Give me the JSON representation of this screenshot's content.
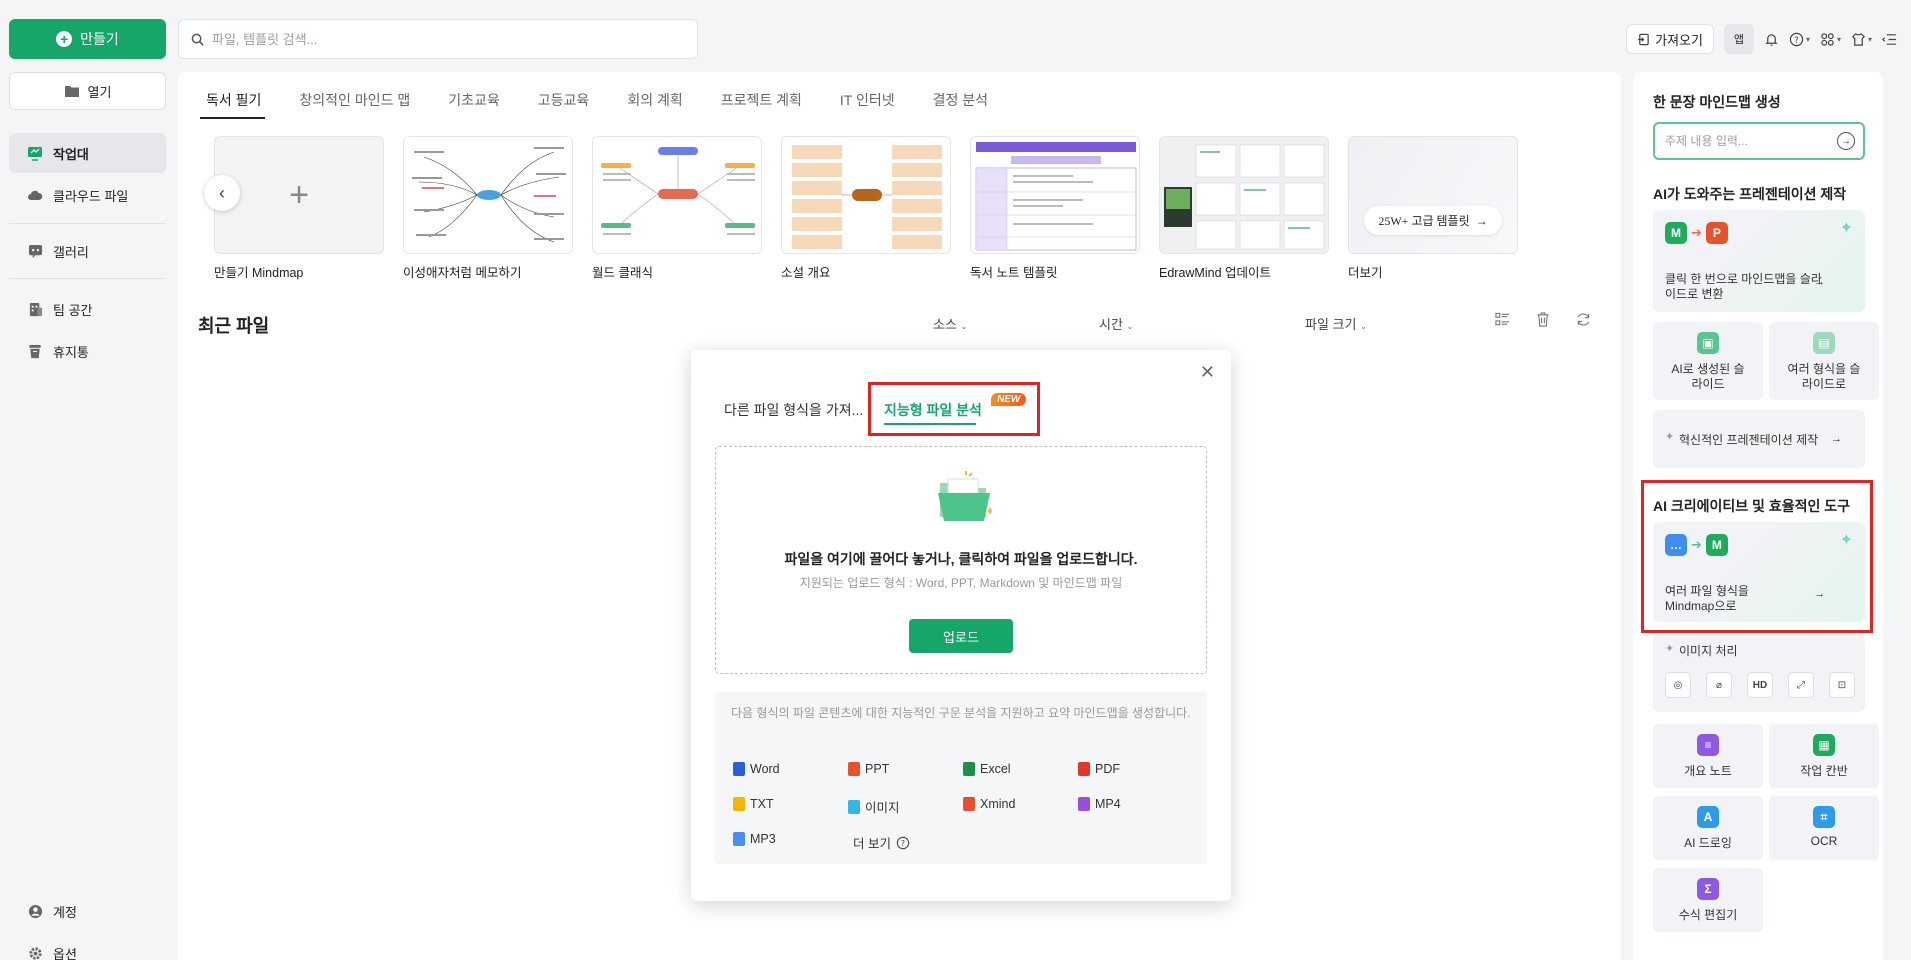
{
  "toolbar": {
    "create_label": "만들기",
    "search_placeholder": "파일, 템플릿 검색...",
    "import_label": "가져오기",
    "app_label": "앱"
  },
  "sidebar": {
    "open_label": "열기",
    "items": [
      {
        "label": "작업대"
      },
      {
        "label": "클라우드 파일"
      },
      {
        "label": "갤러리"
      },
      {
        "label": "팀 공간"
      },
      {
        "label": "휴지통"
      }
    ],
    "bottom": [
      {
        "label": "계정"
      },
      {
        "label": "옵션"
      }
    ]
  },
  "main": {
    "tabs": [
      {
        "label": "독서 필기"
      },
      {
        "label": "창의적인 마인드 맵"
      },
      {
        "label": "기초교육"
      },
      {
        "label": "고등교육"
      },
      {
        "label": "회의 계획"
      },
      {
        "label": "프로젝트 계획"
      },
      {
        "label": "IT 인터넷"
      },
      {
        "label": "결정 분석"
      }
    ],
    "templates": [
      {
        "label": "만들기 Mindmap"
      },
      {
        "label": "이성애자처럼 메모하기"
      },
      {
        "label": "월드 클래식"
      },
      {
        "label": "소설 개요"
      },
      {
        "label": "독서 노트 템플릿"
      },
      {
        "label": "EdrawMind 업데이트"
      },
      {
        "label": "더보기"
      }
    ],
    "more_pill": "25W+ 고급 템플릿",
    "recent_title": "최근 파일",
    "columns": {
      "source": "소스",
      "time": "시간",
      "size": "파일 크기"
    }
  },
  "dialog": {
    "tab1": "다른 파일 형식을 가져...",
    "tab2": "지능형 파일 분석",
    "badge": "NEW",
    "drop_main": "파일을 여기에 끌어다 놓거나, 클릭하여 파일을 업로드합니다.",
    "drop_sub": "지원되는 업로드 형식 : Word, PPT, Markdown 및 마인드맵 파일",
    "upload_label": "업로드",
    "info": "다음 형식의 파일 콘텐츠에 대한 지능적인 구문 분석을 지원하고 요약 마인드맵을 생성합니다.",
    "formats": [
      {
        "label": "Word",
        "color": "#2b5fd9"
      },
      {
        "label": "PPT",
        "color": "#e5532d"
      },
      {
        "label": "Excel",
        "color": "#1e8e4f"
      },
      {
        "label": "PDF",
        "color": "#e0392b"
      },
      {
        "label": "TXT",
        "color": "#f4b400"
      },
      {
        "label": "이미지",
        "color": "#33b6e8"
      },
      {
        "label": "Xmind",
        "color": "#e94e2e"
      },
      {
        "label": "MP4",
        "color": "#9b4de0"
      },
      {
        "label": "MP3",
        "color": "#4a8ef0"
      }
    ],
    "more_label": "더 보기"
  },
  "right": {
    "h1": "한 문장 마인드맵 생성",
    "topic_placeholder": "주제 내용 입력...",
    "h2": "AI가 도와주는 프레젠테이션 제작",
    "card1": "클릭 한 번으로 마인드맵을 슬라이드로 변환",
    "small1": "AI로 생성된 슬라이드",
    "small2": "여러 형식을 슬라이드로",
    "innov": "혁신적인 프레젠테이션 제작",
    "h3": "AI 크리에이티브 및 효율적인 도구",
    "card2": "여러 파일 형식을 Mindmap으로",
    "image_proc": "이미지 처리",
    "image_tools": [
      "HD"
    ],
    "tools": [
      {
        "label": "개요 노트",
        "color": "#8e57e6"
      },
      {
        "label": "작업 칸반",
        "color": "#1faa5c"
      },
      {
        "label": "AI 드로잉",
        "color": "#2f9ae8"
      },
      {
        "label": "OCR",
        "color": "#2f9ae8"
      },
      {
        "label": "수식 편집기",
        "color": "#8e57e6"
      }
    ]
  },
  "colors": {
    "accent": "#16a66a",
    "highlight": "#e02424"
  }
}
